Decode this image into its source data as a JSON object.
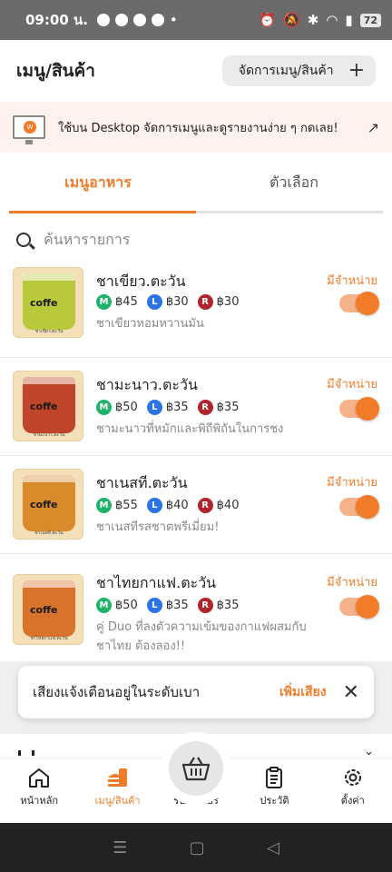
{
  "status_bar": {
    "time": "09:00 น.",
    "battery": "72"
  },
  "header": {
    "title": "เมนู/สินค้า",
    "manage_label": "จัดการเมนู/สินค้า"
  },
  "banner": {
    "text": "ใช้บน Desktop จัดการเมนูและดูรายงานง่าย ๆ กดเลย!"
  },
  "tabs": [
    {
      "label": "เมนูอาหาร",
      "active": true
    },
    {
      "label": "ตัวเลือก",
      "active": false
    }
  ],
  "search": {
    "placeholder": "ค้นหารายการ"
  },
  "items": [
    {
      "name": "ชาเขียว.ตะวัน",
      "desc": "ชาเขียวหอมหวานมัน",
      "prices": [
        "฿45",
        "฿30",
        "฿30"
      ],
      "status": "มีจำหน่าย",
      "caption": "ชาเขียว.ตะวัน",
      "cup_color": "#b9c93a",
      "available": true
    },
    {
      "name": "ชามะนาว.ตะวัน",
      "desc": "ชามะนาวที่หมักและพิถีพิถันในการชง",
      "prices": [
        "฿50",
        "฿35",
        "฿35"
      ],
      "status": "มีจำหน่าย",
      "caption": "ชามะนาว.ตะวัน",
      "cup_color": "#c0442a",
      "available": true
    },
    {
      "name": "ชาเนสที.ตะวัน",
      "desc": "ชาเนสทีรสชาตพรีเมี่ยม!",
      "prices": [
        "฿55",
        "฿40",
        "฿40"
      ],
      "status": "มีจำหน่าย",
      "caption": "ชาเนสที.ตะวัน",
      "cup_color": "#d98a2a",
      "available": true
    },
    {
      "name": "ชาไทยกาแฟ.ตะวัน",
      "desc": "คู่ Duo ที่ลงตัวความเข้มของกาแฟผสมกับชาไทย ต้องลอง!!",
      "prices": [
        "฿50",
        "฿35",
        "฿35"
      ],
      "status": "มีจำหน่าย",
      "caption": "ชาไทยกาแฟ.ตะวัน",
      "cup_color": "#d9722a",
      "available": true
    }
  ],
  "toast": {
    "text": "เสียงแจ้งเตือนอยู่ในระดับเบา",
    "action": "เพิ่มเสียง"
  },
  "bottom_nav": [
    {
      "label": "หน้าหลัก",
      "icon": "home-icon"
    },
    {
      "label": "เมนู/สินค้า",
      "icon": "burger-drink-icon",
      "active": true
    },
    {
      "label": "รับออเดอร์",
      "icon": "basket-icon"
    },
    {
      "label": "ประวัติ",
      "icon": "clipboard-icon"
    },
    {
      "label": "ตั้งค่า",
      "icon": "gear-icon"
    }
  ],
  "colors": {
    "accent": "#f07c2a",
    "grab": "#1fb36a",
    "lineman": "#2a74e8",
    "robinhood": "#b0252b"
  }
}
